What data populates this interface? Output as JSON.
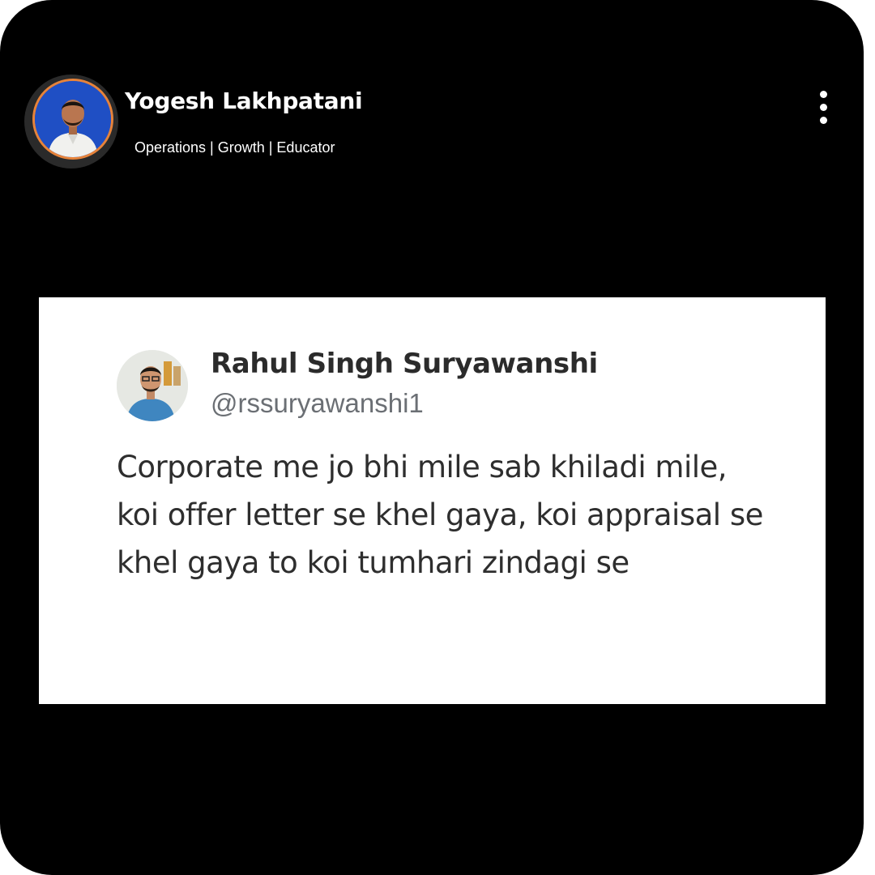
{
  "post": {
    "author": {
      "name": "Yogesh Lakhpatani",
      "tagline": "Operations | Growth | Educator",
      "avatar_icon": "profile-photo",
      "ring_color": "#e7833a"
    },
    "menu_icon": "more-vertical-icon"
  },
  "tweet": {
    "author_name": "Rahul Singh Suryawanshi",
    "handle": "@rssuryawanshi1",
    "avatar_icon": "profile-photo",
    "text": "Corporate me jo bhi mile sab khiladi mile, koi offer letter se khel gaya, koi appraisal se khel gaya to koi tumhari zindagi se"
  }
}
